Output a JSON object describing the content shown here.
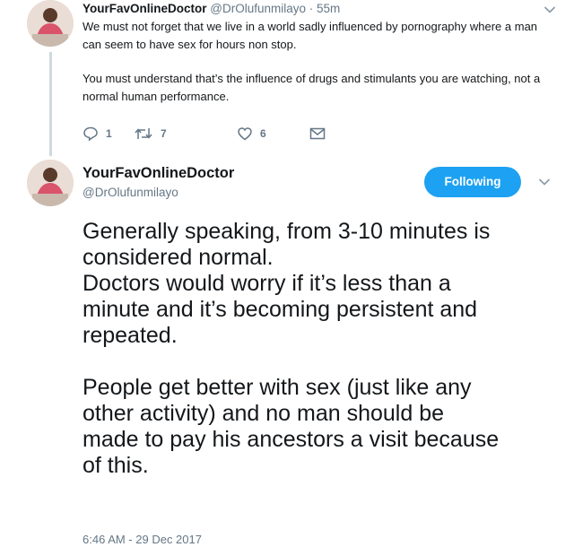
{
  "parent_tweet": {
    "author_name": "YourFavOnlineDoctor",
    "author_handle": "@DrOlufunmilayo",
    "separator": " · ",
    "time": "55m",
    "paragraphs": [
      "We must not forget that we live in a world sadly influenced by pornography where a man can seem to have sex for hours non stop.",
      "You must understand that’s the influence of drugs and stimulants you are watching, not a normal human performance."
    ],
    "reply_count": "1",
    "retweet_count": "7",
    "like_count": "6",
    "icons": {
      "reply": "reply-icon",
      "retweet": "retweet-icon",
      "like": "heart-icon",
      "dm": "envelope-icon",
      "menu": "chevron-down-icon"
    }
  },
  "main_tweet": {
    "author_name": "YourFavOnlineDoctor",
    "author_handle": "@DrOlufunmilayo",
    "follow_label": "Following",
    "lines_para1": [
      "Generally speaking, from 3-10 minutes is",
      "considered normal.",
      "Doctors would worry if it’s less than a",
      "minute and it’s becoming persistent and",
      "repeated."
    ],
    "lines_para2": [
      "People get better with sex (just like any",
      "other activity) and no man should be",
      "made to pay his ancestors a visit because",
      "of this."
    ],
    "timestamp": "6:46 AM - 29 Dec 2017"
  },
  "colors": {
    "accent": "#1da1f2",
    "text": "#14171a",
    "muted": "#657786",
    "thread_line": "#cfd9de"
  }
}
